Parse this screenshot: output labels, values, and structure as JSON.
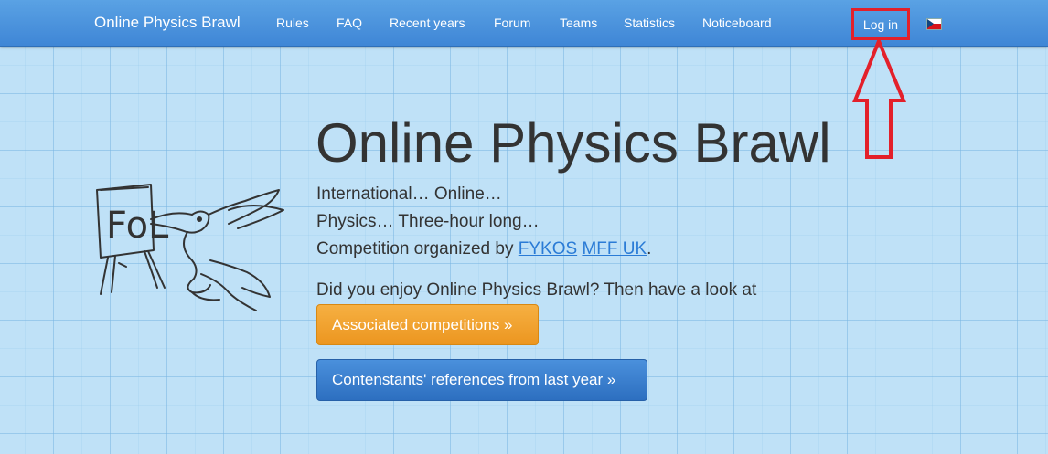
{
  "navbar": {
    "brand": "Online Physics Brawl",
    "items": [
      "Rules",
      "FAQ",
      "Recent years",
      "Forum",
      "Teams",
      "Statistics",
      "Noticeboard"
    ],
    "login": "Log in",
    "language_flag": "czech-flag-icon"
  },
  "hero": {
    "title": "Online Physics Brawl",
    "line1": "International… Online…",
    "line2": "Physics… Three-hour long…",
    "line3_prefix": "Competition organized by ",
    "link_fykos": "FYKOS",
    "link_mff": "MFF UK",
    "line3_suffix": ".",
    "prompt": "Did you enjoy Online Physics Brawl? Then have a look at",
    "btn_associated": "Associated competitions »",
    "btn_references": "Contenstants' references from last year »",
    "mascot_sign": "FoL"
  },
  "colors": {
    "navbar": "#4a94dd",
    "highlight": "#e3202a",
    "orange_button": "#f0a030",
    "blue_button": "#3a7fcd"
  }
}
